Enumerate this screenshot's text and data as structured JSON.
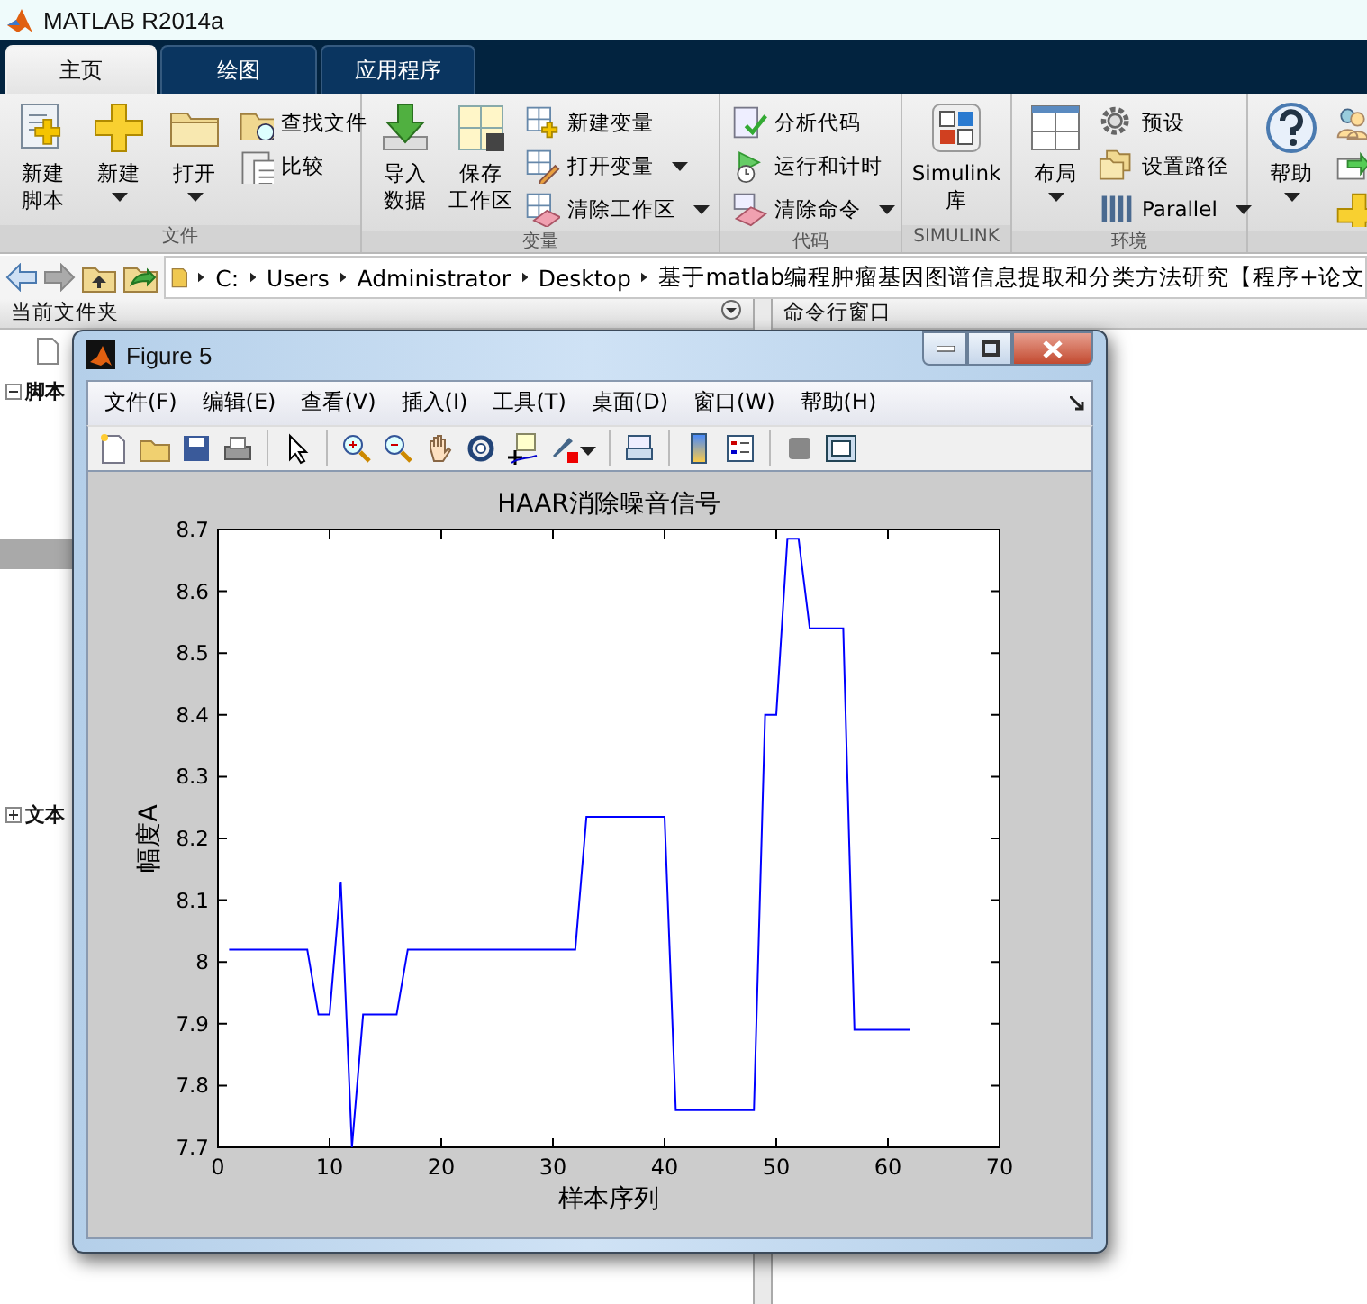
{
  "window": {
    "title": "MATLAB R2014a"
  },
  "tabs": [
    {
      "label": "主页",
      "selected": true
    },
    {
      "label": "绘图",
      "selected": false
    },
    {
      "label": "应用程序",
      "selected": false
    }
  ],
  "ribbon": {
    "sections": [
      {
        "label": "文件",
        "items": [
          {
            "kind": "large",
            "label": [
              "新建",
              "脚本"
            ],
            "dropdown": false
          },
          {
            "kind": "large",
            "label": [
              "新建"
            ],
            "dropdown": true
          },
          {
            "kind": "large",
            "label": [
              "打开"
            ],
            "dropdown": true
          },
          {
            "kind": "small",
            "label": "查找文件",
            "dropdown": false
          },
          {
            "kind": "small",
            "label": "比较",
            "dropdown": false
          }
        ]
      },
      {
        "label": "变量",
        "items": [
          {
            "kind": "large",
            "label": [
              "导入",
              "数据"
            ],
            "dropdown": false
          },
          {
            "kind": "large",
            "label": [
              "保存",
              "工作区"
            ],
            "dropdown": false
          },
          {
            "kind": "small",
            "label": "新建变量",
            "dropdown": false
          },
          {
            "kind": "small",
            "label": "打开变量",
            "dropdown": true
          },
          {
            "kind": "small",
            "label": "清除工作区",
            "dropdown": true
          }
        ]
      },
      {
        "label": "代码",
        "items": [
          {
            "kind": "small",
            "label": "分析代码",
            "dropdown": false
          },
          {
            "kind": "small",
            "label": "运行和计时",
            "dropdown": false
          },
          {
            "kind": "small",
            "label": "清除命令",
            "dropdown": true
          }
        ]
      },
      {
        "label": "SIMULINK",
        "items": [
          {
            "kind": "large",
            "label": [
              "Simulink",
              "库"
            ],
            "dropdown": false
          }
        ]
      },
      {
        "label": "环境",
        "items": [
          {
            "kind": "large",
            "label": [
              "布局"
            ],
            "dropdown": true
          },
          {
            "kind": "small",
            "label": "预设",
            "dropdown": false
          },
          {
            "kind": "small",
            "label": "设置路径",
            "dropdown": false
          },
          {
            "kind": "small",
            "label": "Parallel",
            "dropdown": true
          }
        ]
      },
      {
        "items": [
          {
            "kind": "large",
            "label": [
              "帮助"
            ],
            "dropdown": true
          },
          {
            "kind": "small",
            "dropdown": false
          },
          {
            "kind": "small",
            "dropdown": false
          },
          {
            "kind": "small",
            "dropdown": false
          }
        ]
      }
    ]
  },
  "address_bar": {
    "path": [
      "C:",
      "Users",
      "Administrator",
      "Desktop",
      "基于matlab编程肿瘤基因图谱信息提取和分类方法研究【程序+论文"
    ]
  },
  "current_folder": {
    "title": "当前文件夹",
    "rows": [
      {
        "kind": "file"
      },
      {
        "kind": "group",
        "label": "脚本",
        "expanded": true
      },
      {
        "kind": "row",
        "selected": false
      },
      {
        "kind": "row",
        "selected": false
      },
      {
        "kind": "row",
        "selected": false
      },
      {
        "kind": "row",
        "selected": false
      },
      {
        "kind": "row",
        "selected": true
      },
      {
        "kind": "row",
        "selected": false
      },
      {
        "kind": "row",
        "selected": false
      },
      {
        "kind": "row",
        "selected": false
      },
      {
        "kind": "row",
        "selected": false
      },
      {
        "kind": "row",
        "selected": false
      },
      {
        "kind": "row",
        "selected": false
      },
      {
        "kind": "row",
        "selected": false
      },
      {
        "kind": "group",
        "label": "文本",
        "expanded": false
      }
    ]
  },
  "command_window": {
    "title": "命令行窗口"
  },
  "figure": {
    "title": "Figure 5",
    "menu": [
      "文件(F)",
      "编辑(E)",
      "查看(V)",
      "插入(I)",
      "工具(T)",
      "桌面(D)",
      "窗口(W)",
      "帮助(H)"
    ],
    "chart_data": {
      "type": "line",
      "title": "HAAR消除噪音信号",
      "xlabel": "样本序列",
      "ylabel": "幅度A",
      "x": [
        1,
        2,
        3,
        4,
        5,
        6,
        7,
        8,
        9,
        10,
        11,
        12,
        13,
        14,
        15,
        16,
        17,
        18,
        19,
        20,
        21,
        22,
        23,
        24,
        25,
        26,
        27,
        28,
        29,
        30,
        31,
        32,
        33,
        34,
        35,
        36,
        37,
        38,
        39,
        40,
        41,
        42,
        43,
        44,
        45,
        46,
        47,
        48,
        49,
        50,
        51,
        52,
        53,
        54,
        55,
        56,
        57,
        58,
        59,
        60,
        61,
        62
      ],
      "series": [
        {
          "color": "#0000ff",
          "values": [
            8.02,
            8.02,
            8.02,
            8.02,
            8.02,
            8.02,
            8.02,
            8.02,
            7.915,
            7.915,
            8.13,
            7.7,
            7.915,
            7.915,
            7.915,
            7.915,
            8.02,
            8.02,
            8.02,
            8.02,
            8.02,
            8.02,
            8.02,
            8.02,
            8.02,
            8.02,
            8.02,
            8.02,
            8.02,
            8.02,
            8.02,
            8.02,
            8.235,
            8.235,
            8.235,
            8.235,
            8.235,
            8.235,
            8.235,
            8.235,
            7.76,
            7.76,
            7.76,
            7.76,
            7.76,
            7.76,
            7.76,
            7.76,
            8.4,
            8.4,
            8.685,
            8.685,
            8.54,
            8.54,
            8.54,
            8.54,
            7.89,
            7.89,
            7.89,
            7.89,
            7.89,
            7.89
          ]
        }
      ],
      "xlim": [
        0,
        70
      ],
      "ylim": [
        7.7,
        8.7
      ],
      "xticks": [
        0,
        10,
        20,
        30,
        40,
        50,
        60,
        70
      ],
      "yticks": [
        7.7,
        7.8,
        7.9,
        8,
        8.1,
        8.2,
        8.3,
        8.4,
        8.5,
        8.6,
        8.7
      ]
    }
  }
}
